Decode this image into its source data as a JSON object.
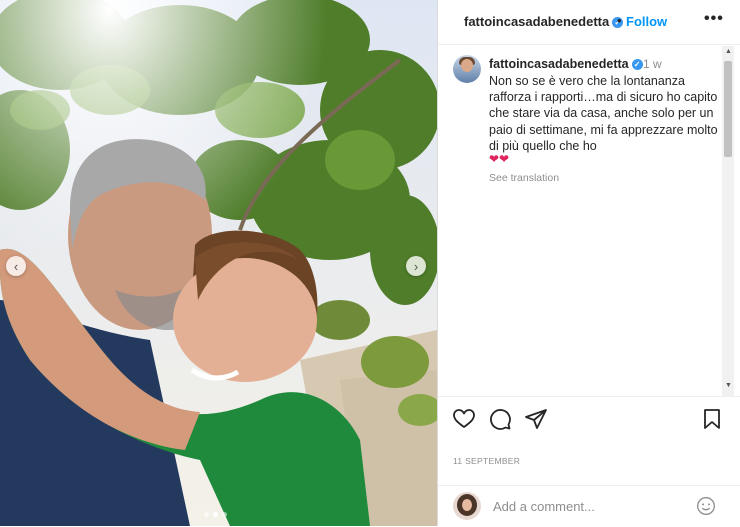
{
  "post": {
    "username": "fattoincasadabenedetta",
    "follow_label": "Follow",
    "more_label": "•••",
    "caption_username": "fattoincasadabenedetta",
    "caption_time": "1 w",
    "caption_text": "Non so se è vero che la lontananza rafforza i rapporti…ma di sicuro ho capito che stare via da casa, anche solo per un paio di settimane, mi fa apprezzare molto di più quello che ho",
    "caption_hearts": "❤❤",
    "see_translation": "See translation",
    "date": "11 SEPTEMBER",
    "comment_placeholder": "Add a comment..."
  },
  "carousel": {
    "slide_count": 3,
    "active_slide": 2
  },
  "icons": [
    "verified-icon",
    "more-icon",
    "heart-icon",
    "comment-icon",
    "share-icon",
    "bookmark-icon",
    "emoji-icon",
    "chevron-left-icon",
    "chevron-right-icon"
  ],
  "colors": {
    "accent": "#0095f6",
    "verified": "#3897f0",
    "hearts": "#e0245e",
    "muted": "#8e8e8e"
  }
}
